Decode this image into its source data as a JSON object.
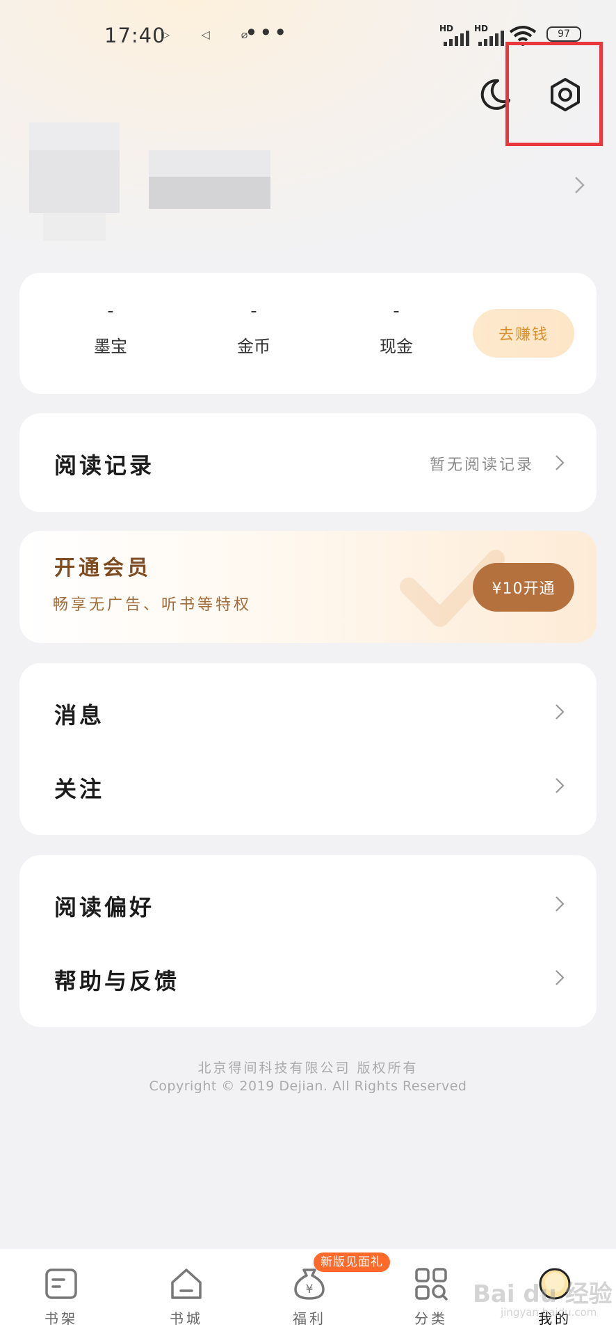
{
  "status_bar": {
    "time": "17:40",
    "indicator_icons": "▷ ◁ ⌀",
    "more_dots": "•••",
    "network_1": "HD",
    "network_2": "HD",
    "battery": "97"
  },
  "header": {
    "night_mode_icon": "moon-icon",
    "settings_icon": "hexagon-gear-icon",
    "highlight_color": "#e8383d"
  },
  "profile": {
    "chevron_icon": "chevron-right-icon"
  },
  "wallet": {
    "stats": [
      {
        "value": "-",
        "label": "墨宝"
      },
      {
        "value": "-",
        "label": "金币"
      },
      {
        "value": "-",
        "label": "现金"
      }
    ],
    "earn_button": "去赚钱"
  },
  "reading_history": {
    "title": "阅读记录",
    "status": "暂无阅读记录"
  },
  "vip": {
    "title": "开通会员",
    "subtitle": "畅享无广告、听书等特权",
    "button": "¥10开通"
  },
  "menu_group_1": [
    {
      "label": "消息"
    },
    {
      "label": "关注"
    }
  ],
  "menu_group_2": [
    {
      "label": "阅读偏好"
    },
    {
      "label": "帮助与反馈"
    }
  ],
  "footer": {
    "company": "北京得间科技有限公司 版权所有",
    "copyright": "Copyright © 2019 Dejian. All Rights Reserved"
  },
  "tabbar": {
    "items": [
      {
        "label": "书架",
        "icon": "bookshelf-icon"
      },
      {
        "label": "书城",
        "icon": "bookstore-home-icon"
      },
      {
        "label": "福利",
        "icon": "money-bag-icon"
      },
      {
        "label": "分类",
        "icon": "category-grid-icon"
      },
      {
        "label": "我的",
        "icon": "avatar-icon"
      }
    ],
    "badge": "新版见面礼",
    "active_index": 4
  },
  "watermark": {
    "text": "Bai du 经验",
    "sub": "jingyan.baidu.com"
  }
}
